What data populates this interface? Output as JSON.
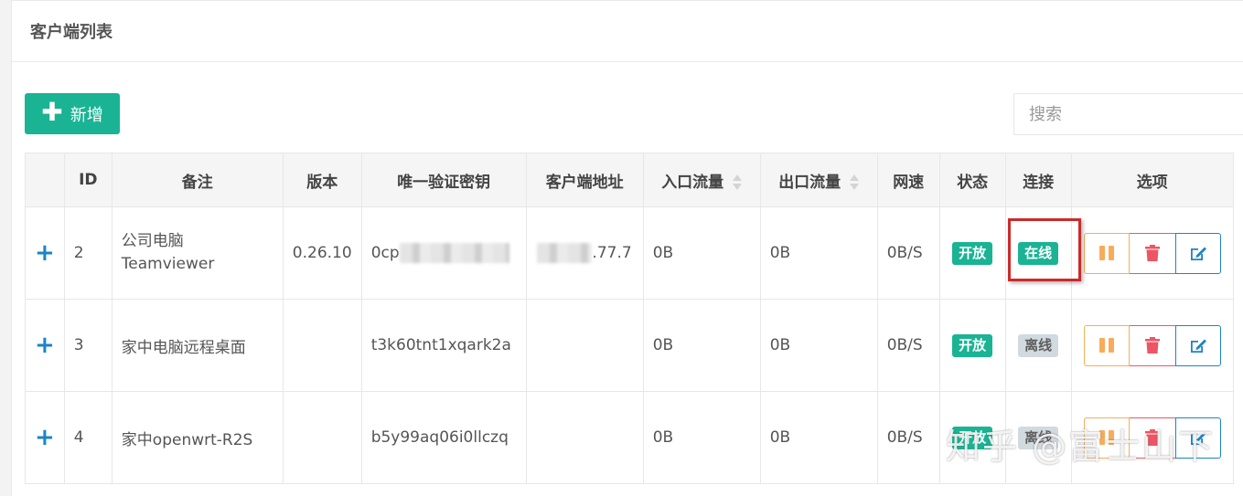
{
  "panel": {
    "title": "客户端列表"
  },
  "toolbar": {
    "add_label": "新增",
    "search_placeholder": "搜索"
  },
  "table": {
    "headers": [
      "ID",
      "备注",
      "版本",
      "唯一验证密钥",
      "客户端地址",
      "入口流量",
      "出口流量",
      "网速",
      "状态",
      "连接",
      "选项"
    ],
    "rows": [
      {
        "id": "2",
        "remark_line1": "公司电脑",
        "remark_line2": "Teamviewer",
        "version": "0.26.10",
        "key_prefix": "0cp",
        "address_suffix": ".77.7",
        "in_traffic": "0B",
        "out_traffic": "0B",
        "speed": "0B/S",
        "status": "开放",
        "connection": "在线"
      },
      {
        "id": "3",
        "remark_line1": "家中电脑远程桌面",
        "version": "",
        "key": "t3k60tnt1xqark2a",
        "address": "",
        "in_traffic": "0B",
        "out_traffic": "0B",
        "speed": "0B/S",
        "status": "开放",
        "connection": "离线"
      },
      {
        "id": "4",
        "remark_line1": "家中openwrt-R2S",
        "version": "",
        "key": "b5y99aq06i0llczq",
        "address": "",
        "in_traffic": "0B",
        "out_traffic": "0B",
        "speed": "0B/S",
        "status": "开放",
        "connection": "离线"
      }
    ]
  },
  "icons": {
    "expand": "plus-icon",
    "pause": "pause-icon",
    "delete": "trash-icon",
    "edit": "edit-icon"
  },
  "colors": {
    "primary": "#1ab394",
    "warning": "#f8ac59",
    "danger": "#ed5565",
    "info": "#1c84c6",
    "offline": "#d1dade",
    "highlight": "#cc2a2a"
  },
  "watermark": "知乎 @富士山下"
}
